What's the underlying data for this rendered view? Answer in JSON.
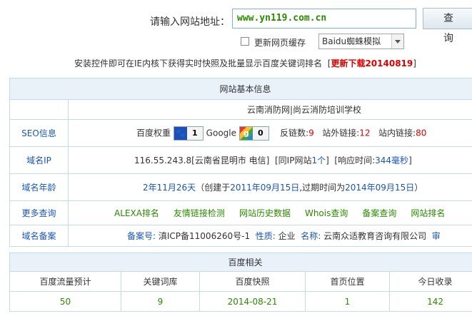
{
  "query": {
    "label": "请输入网站地址：",
    "url_value": "www.yn119.com.cn",
    "button_label": "查 询",
    "refresh_label": "更新网页缓存",
    "ua_selected": "Baidu蜘蛛模拟"
  },
  "notice": {
    "text": "安装控件即可在IE内核下获得实时快照及批量显示百度关键词排名",
    "bracket_open": "[",
    "link": "更新下载20140819",
    "bracket_close": "]"
  },
  "basic": {
    "header": "网站基本信息",
    "site_title": "云南消防网|尚云消防培训学校",
    "seo": {
      "label": "SEO信息",
      "baidu_weight_label": "百度权重",
      "baidu_weight_value": "1",
      "google_label": "Google",
      "google_value": "0",
      "reverse_links_label": "反链数:",
      "reverse_links_value": "9",
      "outbound_label": "站外链接:",
      "outbound_value": "12",
      "inbound_label": "站内链接:",
      "inbound_value": "80"
    },
    "ip": {
      "label": "域名IP",
      "ip_text": "116.55.243.8[云南省昆明市 电信]",
      "same_ip_prefix": "[同IP网站",
      "same_ip_count": "1个",
      "same_ip_suffix": "]",
      "resp_prefix": "[响应时间:",
      "resp_value": "344毫秒",
      "resp_suffix": "]"
    },
    "age": {
      "label": "域名年龄",
      "age_value": "2年11月26天",
      "created_prefix": "（创建于",
      "created_date": "2011年09月15日",
      "expire_prefix": ",过期时间为",
      "expire_date": "2014年09月15日",
      "suffix": "）"
    },
    "more": {
      "label": "更多查询",
      "links": [
        "ALEXA排名",
        "友情链接检测",
        "网站历史数据",
        "Whois查询",
        "备案查询",
        "网站排名"
      ]
    },
    "icp": {
      "label": "域名备案",
      "icp_label": "备案号:",
      "icp_value": "滇ICP备11006260号-1",
      "nature_label": "性质:",
      "nature_value": "企业",
      "name_label": "名称:",
      "name_value": "云南众适教育咨询有限公司",
      "trail": "审"
    }
  },
  "baidu": {
    "header": "百度相关",
    "columns": [
      "百度流量预计",
      "关键词库",
      "百度快照",
      "首页位置",
      "今日收录"
    ],
    "values": [
      "50",
      "9",
      "2014-08-21",
      "1",
      "142"
    ]
  },
  "colors": {
    "link_blue": "#1a55b8",
    "highlight_red": "#e00000",
    "link_green": "#2a8a00",
    "header_bg": "#e9f1f9",
    "border": "#c5d9ea"
  }
}
